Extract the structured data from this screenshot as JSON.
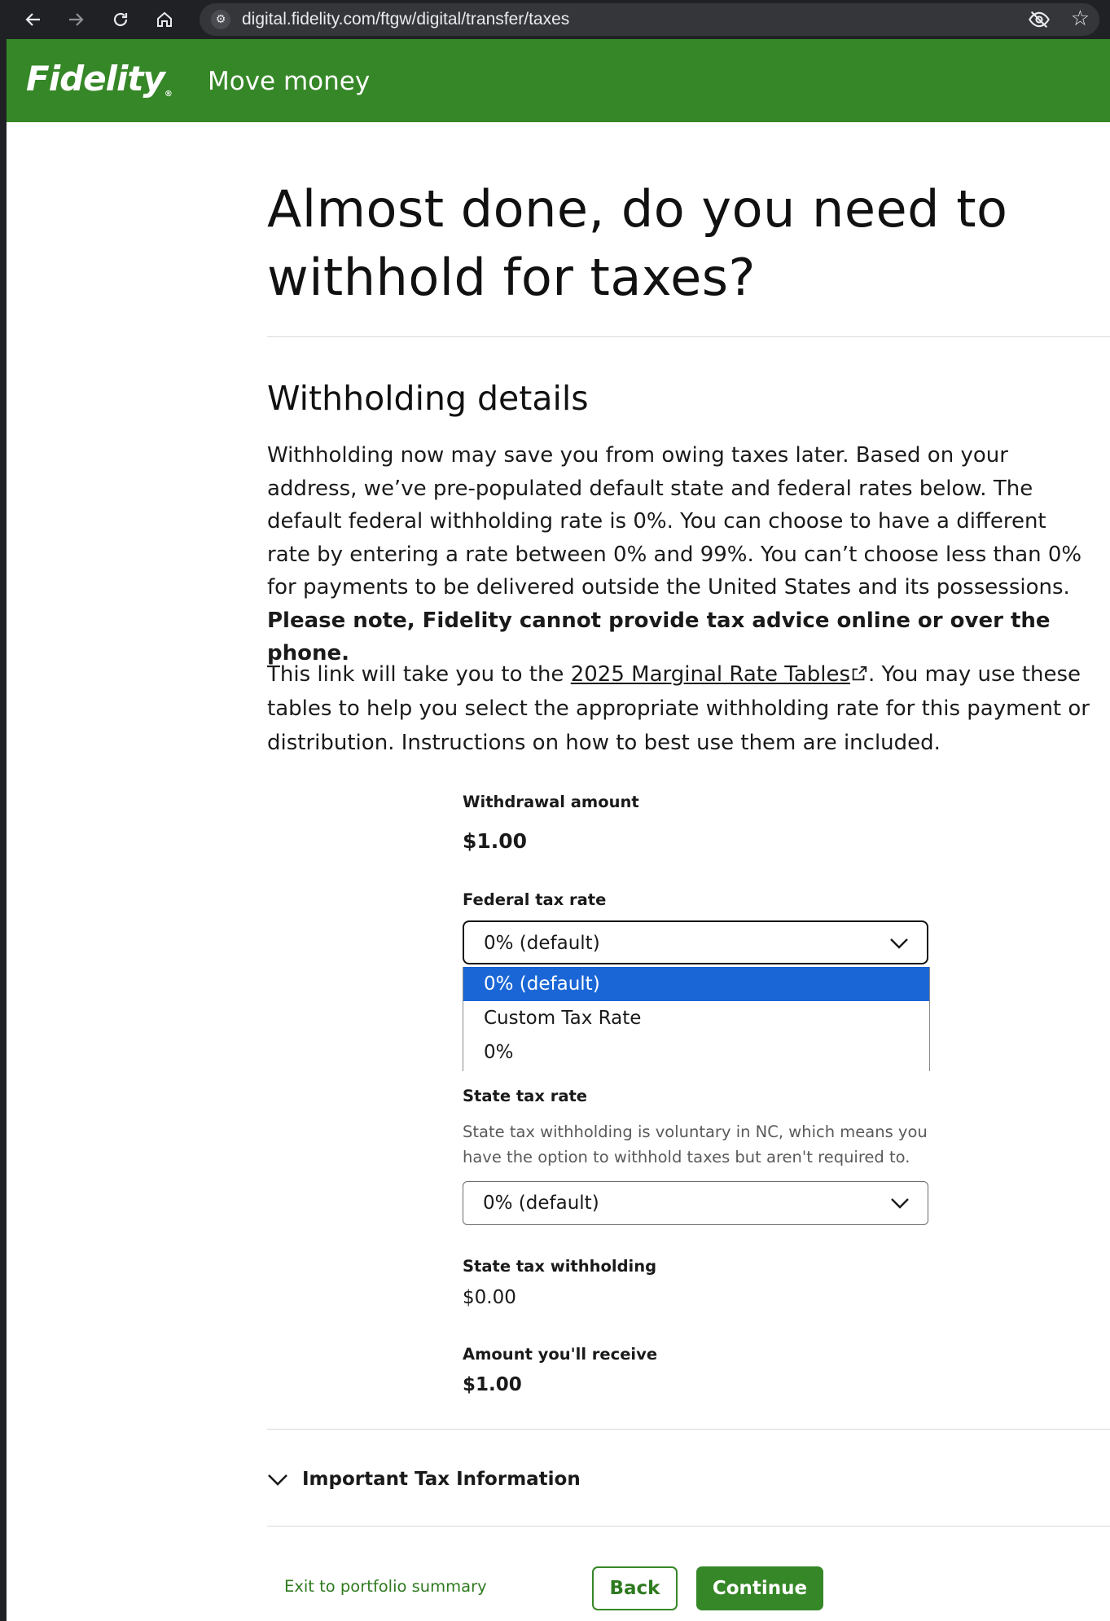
{
  "browser": {
    "url": "digital.fidelity.com/ftgw/digital/transfer/taxes",
    "back_icon": "arrow-left-icon",
    "forward_icon": "arrow-right-icon",
    "reload_icon": "reload-icon",
    "home_icon": "home-icon"
  },
  "header": {
    "logo": "Fidelity",
    "title": "Move money",
    "color": "#368727"
  },
  "page": {
    "title": "Almost done, do you need to withhold for taxes?",
    "section_title": "Withholding details",
    "intro_text": "Withholding now may save you from owing taxes later. Based on your address, we’ve pre-populated default state and federal rates below. The default federal withholding rate is 0%. You can choose to have a different rate by entering a rate between 0% and 99%. You can’t choose less than 0% for payments to be delivered outside the United States and its possessions.",
    "intro_bold": "Please note, Fidelity cannot provide tax advice online or over the phone.",
    "link_prefix": "This link will take you to the ",
    "link_text": "2025 Marginal Rate Tables",
    "link_suffix": ". You may use these tables to help you select the appropriate withholding rate for this payment or distribution. Instructions on how to best use them are included."
  },
  "form": {
    "withdrawal_label": "Withdrawal amount",
    "withdrawal_value": "$1.00",
    "federal_label": "Federal tax rate",
    "federal_selected": "0% (default)",
    "federal_options": [
      "0% (default)",
      "Custom Tax Rate",
      "0%"
    ],
    "state_label": "State tax rate",
    "state_hint": "State tax withholding is voluntary in NC, which means you have the option to withhold taxes but aren't required to.",
    "state_selected": "0% (default)",
    "state_withholding_label": "State tax withholding",
    "state_withholding_value": "$0.00",
    "receive_label": "Amount you'll receive",
    "receive_value": "$1.00"
  },
  "accordion": {
    "label": "Important Tax Information"
  },
  "footer": {
    "exit_link": "Exit to portfolio summary",
    "back_label": "Back",
    "continue_label": "Continue"
  }
}
